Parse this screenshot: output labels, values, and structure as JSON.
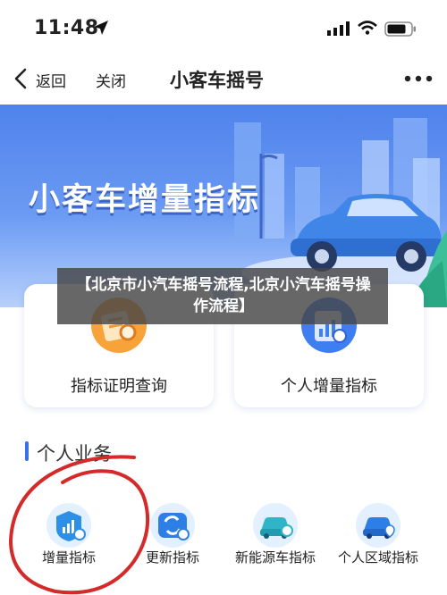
{
  "status_bar": {
    "time": "11:48"
  },
  "nav": {
    "back_label": "返回",
    "close_label": "关闭",
    "title": "小客车摇号"
  },
  "banner": {
    "title": "小客车增量指标"
  },
  "cards": [
    {
      "label": "指标证明查询"
    },
    {
      "label": "个人增量指标"
    }
  ],
  "overlay": {
    "text": "【北京市小汽车摇号流程,北京小汽车摇号操作流程】"
  },
  "section": {
    "title": "个人业务"
  },
  "services": [
    {
      "label": "增量指标"
    },
    {
      "label": "更新指标"
    },
    {
      "label": "新能源车指标"
    },
    {
      "label": "个人区域指标"
    }
  ],
  "colors": {
    "accent": "#3a6fe6",
    "banner": "#5b8cf0",
    "annotation": "#d42a2a"
  }
}
